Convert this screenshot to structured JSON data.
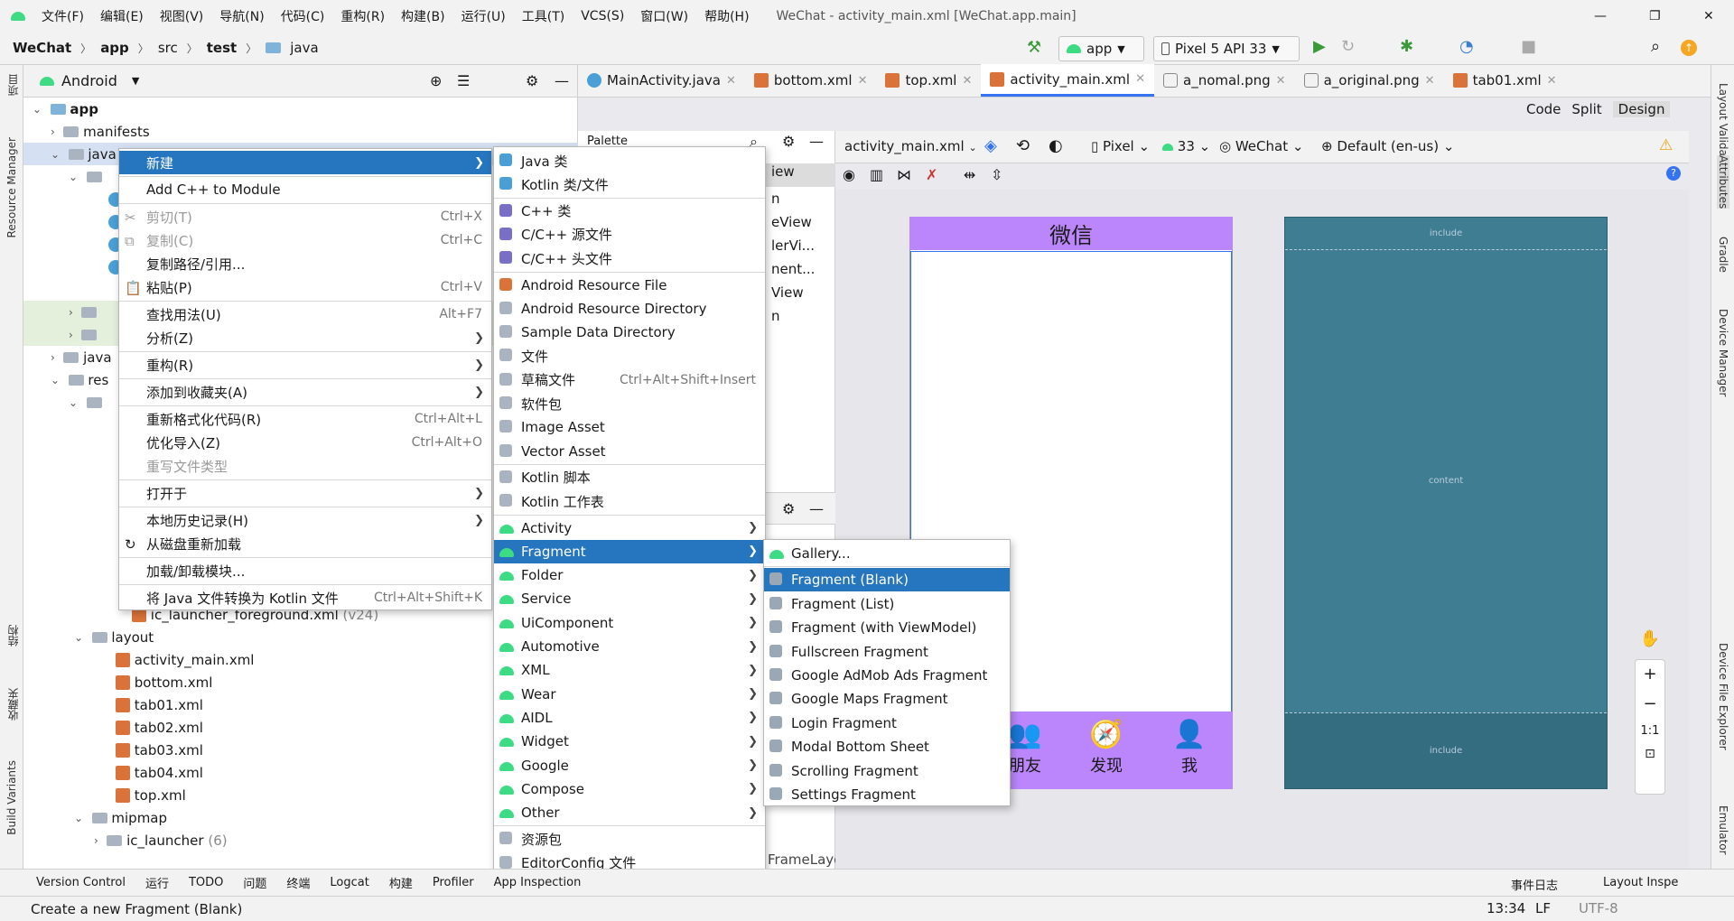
{
  "menubar": {
    "items": [
      "文件(F)",
      "编辑(E)",
      "视图(V)",
      "导航(N)",
      "代码(C)",
      "重构(R)",
      "构建(B)",
      "运行(U)",
      "工具(T)",
      "VCS(S)",
      "窗口(W)",
      "帮助(H)"
    ],
    "title": "WeChat - activity_main.xml [WeChat.app.main]"
  },
  "breadcrumb": [
    "WeChat",
    "app",
    "src",
    "test",
    "java"
  ],
  "run": {
    "config": "app",
    "device": "Pixel 5 API 33"
  },
  "tabs": [
    "MainActivity.java",
    "bottom.xml",
    "top.xml",
    "activity_main.xml",
    "a_nomal.png",
    "a_original.png",
    "tab01.xml"
  ],
  "view_modes": [
    "Code",
    "Split",
    "Design"
  ],
  "project": {
    "selector": "Android",
    "tree": [
      "app",
      "manifests",
      "java",
      "java",
      "res",
      "ic_launcher_foreground.xml",
      "(v24)",
      "layout",
      "activity_main.xml",
      "bottom.xml",
      "tab01.xml",
      "tab02.xml",
      "tab03.xml",
      "tab04.xml",
      "top.xml",
      "mipmap",
      "ic_launcher",
      "(6)"
    ]
  },
  "left_tools": [
    "项目",
    "Resource Manager",
    "结构",
    "收藏夹",
    "Build Variants"
  ],
  "right_tools": [
    "Layout Validation",
    "Attributes",
    "Gradle",
    "Device Manager",
    "Device File Explorer",
    "Emulator"
  ],
  "palette": {
    "title": "Palette",
    "items": [
      "iew",
      "n",
      "eView",
      "lerVi...",
      "nent...",
      "View",
      "n"
    ]
  },
  "design_toolbar": {
    "file": "activity_main.xml",
    "device": "Pixel",
    "api": "33",
    "theme": "WeChat",
    "locale": "Default (en-us)"
  },
  "phone": {
    "title": "微信",
    "tabs": [
      "朋友",
      "发现",
      "我"
    ]
  },
  "blueprint": {
    "top": "include",
    "middle": "content",
    "bottom": "include"
  },
  "zoom": {
    "fit": "1:1"
  },
  "component_tree": {
    "root": "FrameLayout"
  },
  "context_menu": [
    {
      "label": "新建",
      "sub": true,
      "sel": true
    },
    {
      "label": "Add C++ to Module"
    },
    {
      "label": "剪切(T)",
      "sc": "Ctrl+X",
      "dis": true
    },
    {
      "label": "复制(C)",
      "sc": "Ctrl+C",
      "dis": true
    },
    {
      "label": "复制路径/引用..."
    },
    {
      "label": "粘贴(P)",
      "sc": "Ctrl+V"
    },
    {
      "label": "查找用法(U)",
      "sc": "Alt+F7"
    },
    {
      "label": "分析(Z)",
      "sub": true
    },
    {
      "label": "重构(R)",
      "sub": true
    },
    {
      "label": "添加到收藏夹(A)",
      "sub": true
    },
    {
      "label": "重新格式化代码(R)",
      "sc": "Ctrl+Alt+L"
    },
    {
      "label": "优化导入(Z)",
      "sc": "Ctrl+Alt+O"
    },
    {
      "label": "重写文件类型",
      "dis": true
    },
    {
      "label": "打开于",
      "sub": true
    },
    {
      "label": "本地历史记录(H)",
      "sub": true
    },
    {
      "label": "从磁盘重新加载"
    },
    {
      "label": "加载/卸载模块..."
    },
    {
      "label": "将 Java 文件转换为 Kotlin 文件",
      "sc": "Ctrl+Alt+Shift+K"
    }
  ],
  "new_menu": [
    {
      "label": "Java 类"
    },
    {
      "label": "Kotlin 类/文件"
    },
    {
      "label": "C++ 类"
    },
    {
      "label": "C/C++ 源文件"
    },
    {
      "label": "C/C++ 头文件"
    },
    {
      "label": "Android Resource File"
    },
    {
      "label": "Android Resource Directory"
    },
    {
      "label": "Sample Data Directory"
    },
    {
      "label": "文件"
    },
    {
      "label": "草稿文件",
      "sc": "Ctrl+Alt+Shift+Insert"
    },
    {
      "label": "软件包"
    },
    {
      "label": "Image Asset"
    },
    {
      "label": "Vector Asset"
    },
    {
      "label": "Kotlin 脚本"
    },
    {
      "label": "Kotlin 工作表"
    },
    {
      "label": "Activity",
      "sub": true
    },
    {
      "label": "Fragment",
      "sub": true,
      "sel": true
    },
    {
      "label": "Folder",
      "sub": true
    },
    {
      "label": "Service",
      "sub": true
    },
    {
      "label": "UiComponent",
      "sub": true
    },
    {
      "label": "Automotive",
      "sub": true
    },
    {
      "label": "XML",
      "sub": true
    },
    {
      "label": "Wear",
      "sub": true
    },
    {
      "label": "AIDL",
      "sub": true
    },
    {
      "label": "Widget",
      "sub": true
    },
    {
      "label": "Google",
      "sub": true
    },
    {
      "label": "Compose",
      "sub": true
    },
    {
      "label": "Other",
      "sub": true
    },
    {
      "label": "资源包"
    },
    {
      "label": "EditorConfig 文件"
    }
  ],
  "fragment_menu": [
    "Gallery...",
    "Fragment (Blank)",
    "Fragment (List)",
    "Fragment (with ViewModel)",
    "Fullscreen Fragment",
    "Google AdMob Ads Fragment",
    "Google Maps Fragment",
    "Login Fragment",
    "Modal Bottom Sheet",
    "Scrolling Fragment",
    "Settings Fragment"
  ],
  "statusbar": {
    "items": [
      "Version Control",
      "运行",
      "TODO",
      "问题",
      "终端",
      "Logcat",
      "构建",
      "Profiler",
      "App Inspection"
    ],
    "right": [
      "事件日志",
      "Layout Inspe"
    ]
  },
  "bottom": {
    "message": "Create a new Fragment (Blank)",
    "position": "13:34",
    "lf": "LF",
    "enc": "UTF-8"
  },
  "colors": {
    "accent": "#2675bf",
    "purple": "#bb86fc",
    "blueprint": "#3e7d92"
  }
}
